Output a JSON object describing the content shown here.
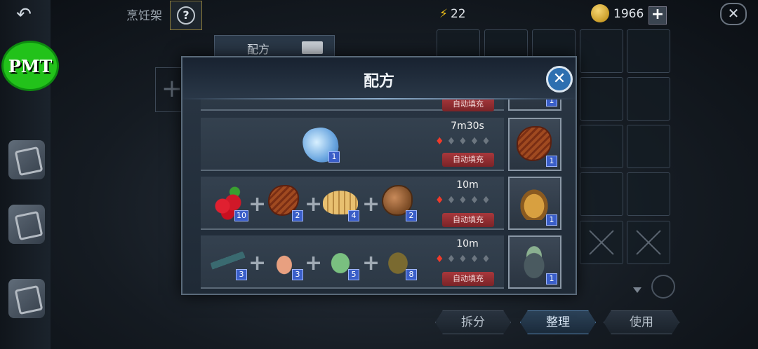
{
  "top_bar": {
    "back_icon": "back-arrow-icon",
    "rack_title": "烹饪架",
    "help_label": "?",
    "energy_value": "22",
    "coin_value": "1966",
    "add_label": "+",
    "close_label": "✕"
  },
  "badge": {
    "text": "PMT"
  },
  "background": {
    "recipe_tab_label": "配方",
    "buttons": [
      "拆分",
      "整理",
      "使用"
    ]
  },
  "dialog": {
    "title": "配方",
    "close_label": "✕",
    "autofill_label": "自动填充",
    "recipes": [
      {
        "time": "7m30s",
        "heat": 1,
        "ingredients": [
          {
            "icon": "ice-crystal-icon",
            "count": "1"
          }
        ],
        "result": {
          "icon": "steak-icon",
          "count": "1"
        }
      },
      {
        "time": "10m",
        "heat": 1,
        "ingredients": [
          {
            "icon": "berries-icon",
            "count": "10"
          },
          {
            "icon": "steak-icon",
            "count": "2"
          },
          {
            "icon": "grub-icon",
            "count": "4"
          },
          {
            "icon": "almond-icon",
            "count": "2"
          }
        ],
        "result": {
          "icon": "soup-bowl-icon",
          "count": "1"
        }
      },
      {
        "time": "10m",
        "heat": 1,
        "ingredients": [
          {
            "icon": "eel-icon",
            "count": "3"
          },
          {
            "icon": "shrimp-icon",
            "count": "3"
          },
          {
            "icon": "fish-icon",
            "count": "5"
          },
          {
            "icon": "turtle-icon",
            "count": "8"
          }
        ],
        "result": {
          "icon": "seafood-pot-icon",
          "count": "1"
        }
      }
    ],
    "partial_top_row": {
      "result_count": "1"
    }
  }
}
